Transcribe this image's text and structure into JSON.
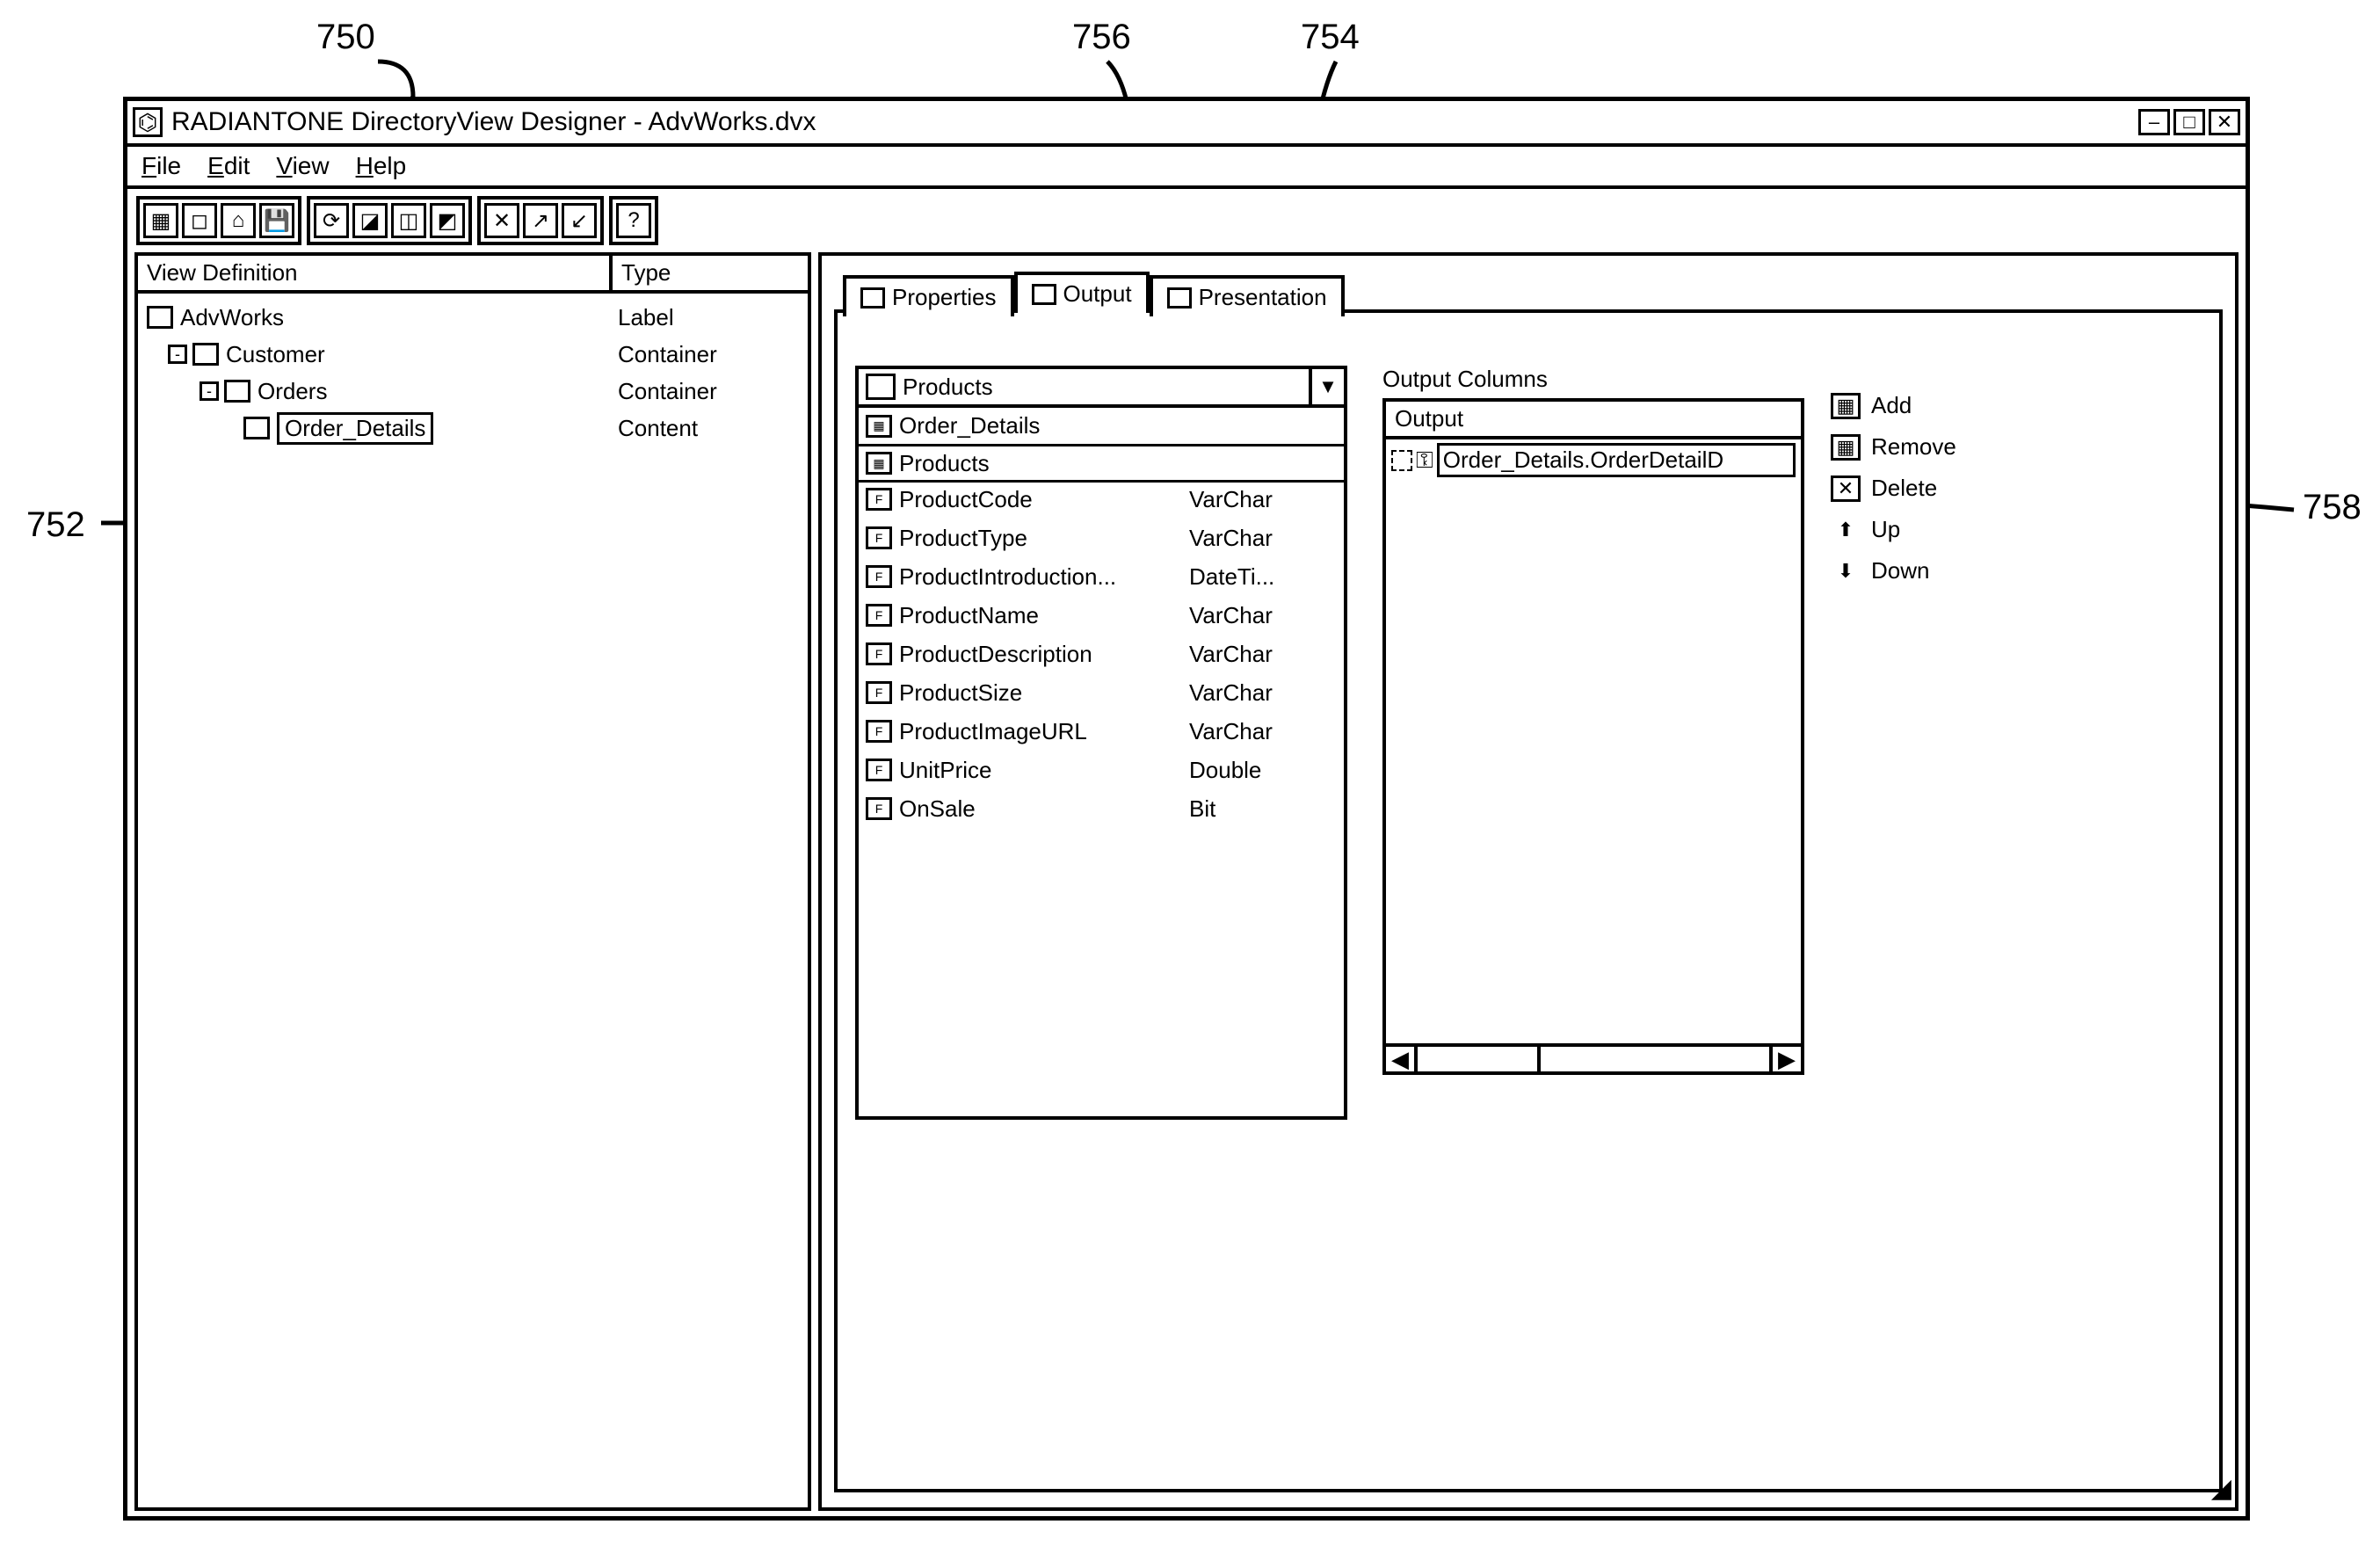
{
  "callouts": {
    "c750": "750",
    "c752": "752",
    "c754": "754",
    "c756": "756",
    "c758": "758"
  },
  "title": "RADIANTONE DirectoryView Designer - AdvWorks.dvx",
  "menus": {
    "file": "File",
    "edit": "Edit",
    "view": "View",
    "help": "Help"
  },
  "leftPane": {
    "headers": {
      "viewdef": "View Definition",
      "type": "Type"
    },
    "rows": [
      {
        "label": "AdvWorks",
        "type": "Label",
        "indent": 0,
        "toggle": ""
      },
      {
        "label": "Customer",
        "type": "Container",
        "indent": 1,
        "toggle": "-"
      },
      {
        "label": "Orders",
        "type": "Container",
        "indent": 2,
        "toggle": "-"
      },
      {
        "label": "Order_Details",
        "type": "Content",
        "indent": 3,
        "toggle": "",
        "selected": true
      }
    ]
  },
  "tabs": {
    "properties": "Properties",
    "output": "Output",
    "presentation": "Presentation"
  },
  "combo": {
    "value": "Products"
  },
  "fieldList": {
    "headers": [
      "Order_Details",
      "Products"
    ],
    "fields": [
      {
        "name": "ProductCode",
        "type": "VarChar"
      },
      {
        "name": "ProductType",
        "type": "VarChar"
      },
      {
        "name": "ProductIntroduction...",
        "type": "DateTi..."
      },
      {
        "name": "ProductName",
        "type": "VarChar"
      },
      {
        "name": "ProductDescription",
        "type": "VarChar"
      },
      {
        "name": "ProductSize",
        "type": "VarChar"
      },
      {
        "name": "ProductImageURL",
        "type": "VarChar"
      },
      {
        "name": "UnitPrice",
        "type": "Double"
      },
      {
        "name": "OnSale",
        "type": "Bit"
      }
    ]
  },
  "outputColumns": {
    "label": "Output Columns",
    "header": "Output",
    "items": [
      "Order_Details.OrderDetailD"
    ]
  },
  "actions": {
    "add": "Add",
    "remove": "Remove",
    "delete": "Delete",
    "up": "Up",
    "down": "Down"
  }
}
